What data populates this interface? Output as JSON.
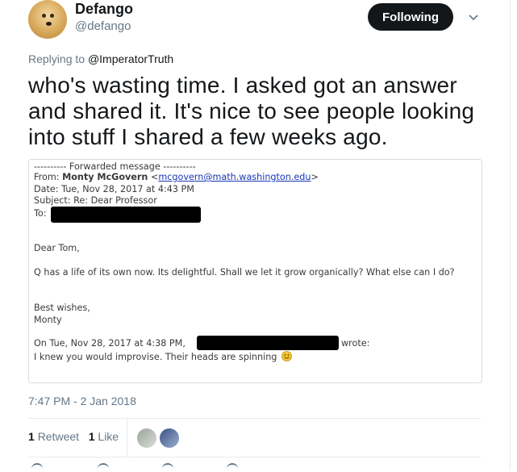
{
  "author": {
    "name": "Defango",
    "handle": "@defango"
  },
  "follow_button": "Following",
  "reply_context": {
    "prefix": "Replying to",
    "mention": "@ImperatorTruth"
  },
  "tweet_text": "who's wasting time. I asked got an answer and shared it. It's nice to see people looking into stuff I shared a few weeks ago.",
  "email": {
    "fwd_header": "---------- Forwarded message ----------",
    "from_label": "From:",
    "from_name": "Monty McGovern",
    "from_email": "mcgovern@math.washington.edu",
    "date_line": "Date: Tue, Nov 28, 2017 at 4:43 PM",
    "subject_line": "Subject: Re: Dear Professor",
    "to_label": "To:",
    "greeting": "Dear Tom,",
    "body": "Q has a life of its own now. Its delightful. Shall we let it grow organically? What else can I do?",
    "signoff": "Best wishes,",
    "signature": "Monty",
    "quote_prefix": "On Tue, Nov 28, 2017 at 4:38 PM,",
    "quote_suffix": "wrote:",
    "quote_text": "I knew you would improvise. Their heads are spinning"
  },
  "timestamp": "7:47 PM - 2 Jan 2018",
  "stats": {
    "retweets_count": "1",
    "retweets_label": "Retweet",
    "likes_count": "1",
    "likes_label": "Like"
  },
  "icons": [
    "chevron-down-icon",
    "smiley-emoji-icon",
    "reply-icon",
    "retweet-icon",
    "like-icon",
    "dm-icon"
  ],
  "colors": {
    "text": "#14171a",
    "muted": "#657786",
    "button_bg": "#14171a",
    "link": "#1a36b5"
  }
}
